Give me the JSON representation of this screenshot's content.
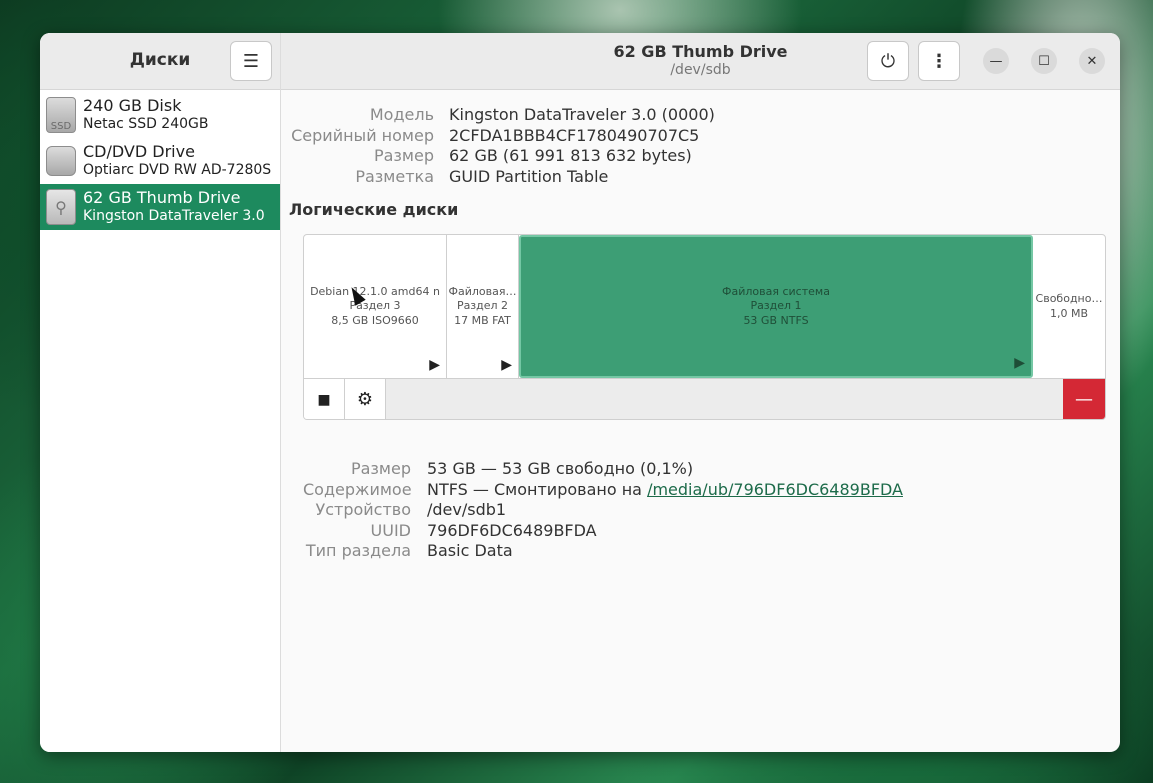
{
  "sidebar": {
    "title": "Диски",
    "devices": [
      {
        "name": "240 GB Disk",
        "model": "Netac SSD 240GB",
        "icon": "ssd-icon",
        "icon_text": "SSD"
      },
      {
        "name": "CD/DVD Drive",
        "model": "Optiarc DVD RW AD-7280S",
        "icon": "optical-drive-icon"
      },
      {
        "name": "62 GB Thumb Drive",
        "model": "Kingston DataTraveler 3.0",
        "icon": "usb-drive-icon",
        "selected": true
      }
    ]
  },
  "header": {
    "title": "62 GB Thumb Drive",
    "subtitle": "/dev/sdb"
  },
  "drive_info": {
    "model_label": "Модель",
    "model_value": "Kingston DataTraveler 3.0 (0000)",
    "serial_label": "Серийный номер",
    "serial_value": "2CFDA1BBB4CF1780490707C5",
    "size_label": "Размер",
    "size_value": "62 GB (61 991 813 632 bytes)",
    "partitioning_label": "Разметка",
    "partitioning_value": "GUID Partition Table"
  },
  "volumes": {
    "title": "Логические диски",
    "partitions": [
      {
        "line1": "Debian 12.1.0 amd64 n",
        "line2": "Раздел 3",
        "line3": "8,5 GB ISO9660",
        "play": "▶"
      },
      {
        "line1": "Файловая…",
        "line2": "Раздел 2",
        "line3": "17 MB FAT",
        "play": "▶"
      },
      {
        "line1": "Файловая система",
        "line2": "Раздел 1",
        "line3": "53 GB NTFS",
        "play": "▶",
        "selected": true
      },
      {
        "line1": "Свободно…",
        "line2": "1,0 MB"
      }
    ]
  },
  "selected_volume": {
    "size_label": "Размер",
    "size_value": "53 GB — 53 GB свободно (0,1%)",
    "contents_label": "Содержимое",
    "contents_prefix": "NTFS — Смонтировано на ",
    "mount_link": "/media/ub/796DF6DC6489BFDA",
    "device_label": "Устройство",
    "device_value": "/dev/sdb1",
    "uuid_label": "UUID",
    "uuid_value": "796DF6DC6489BFDA",
    "type_label": "Тип раздела",
    "type_value": "Basic Data"
  },
  "colors": {
    "accent": "#1d8a5e",
    "selected_partition": "#3d9e75",
    "delete": "#d42835"
  }
}
